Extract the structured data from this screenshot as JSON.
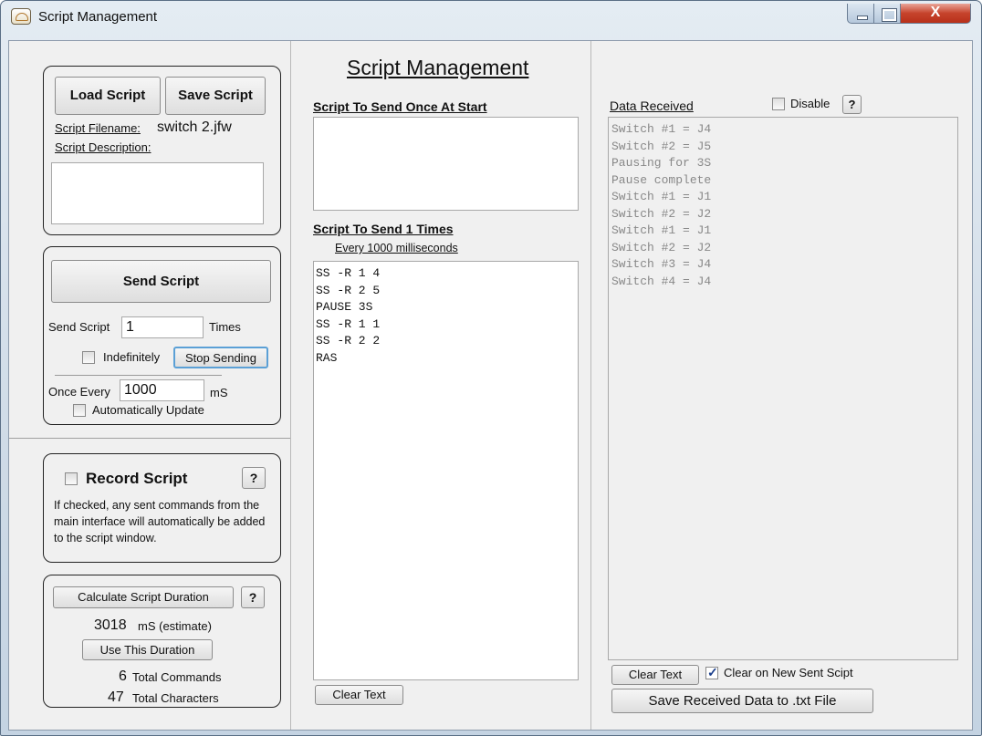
{
  "window": {
    "title": "Script Management",
    "close_glyph": "X"
  },
  "heading": "Script Management",
  "left": {
    "load_script": "Load Script",
    "save_script": "Save Script",
    "filename_label": "Script Filename:",
    "filename_value": "switch 2.jfw",
    "description_label": "Script Description:",
    "description_value": "",
    "send_script": "Send Script",
    "send_script_times_label": "Send Script",
    "times_value": "1",
    "times_suffix": "Times",
    "indefinitely": "Indefinitely",
    "stop_sending": "Stop Sending",
    "once_every_label": "Once Every",
    "once_every_value": "1000",
    "ms_suffix": "mS",
    "auto_update": "Automatically Update",
    "record_script": "Record Script",
    "help": "?",
    "record_desc": "If checked, any sent commands from the main interface will automatically be added to the script window.",
    "calc_duration": "Calculate Script Duration",
    "duration_value": "3018",
    "duration_unit": "mS (estimate)",
    "use_duration": "Use This Duration",
    "total_commands_value": "6",
    "total_commands_label": "Total Commands",
    "total_chars_value": "47",
    "total_chars_label": "Total Characters"
  },
  "middle": {
    "start_label": "Script To Send Once At Start",
    "start_text": "",
    "repeat_label": "Script To Send 1 Times",
    "interval_label": "Every 1000 milliseconds",
    "script_text": "SS -R 1 4\nSS -R 2 5\nPAUSE 3S\nSS -R 1 1\nSS -R 2 2\nRAS",
    "clear_text": "Clear Text"
  },
  "right": {
    "data_received_label": "Data Received",
    "disable": "Disable",
    "help": "?",
    "received_text": "Switch #1 = J4\nSwitch #2 = J5\nPausing for 3S\nPause complete\nSwitch #1 = J1\nSwitch #2 = J2\nSwitch #1 = J1\nSwitch #2 = J2\nSwitch #3 = J4\nSwitch #4 = J4",
    "clear_text": "Clear Text",
    "clear_on_new": "Clear on New Sent Scipt",
    "save_received": "Save Received Data to .txt File"
  }
}
